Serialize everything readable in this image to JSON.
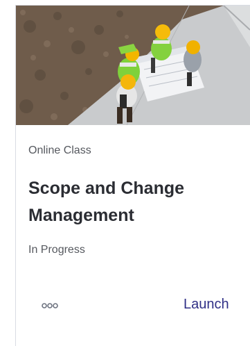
{
  "card": {
    "image_alt_icon": "construction-workers-reviewing-blueprint-image",
    "type_label": "Online Class",
    "title": "Scope and Change Management",
    "status": "In Progress",
    "more_icon": "more-options-icon",
    "launch_label": "Launch"
  },
  "colors": {
    "title": "#2b2d33",
    "secondary_text": "#55585e",
    "launch": "#2f2f86",
    "border": "#d8dbe3"
  }
}
